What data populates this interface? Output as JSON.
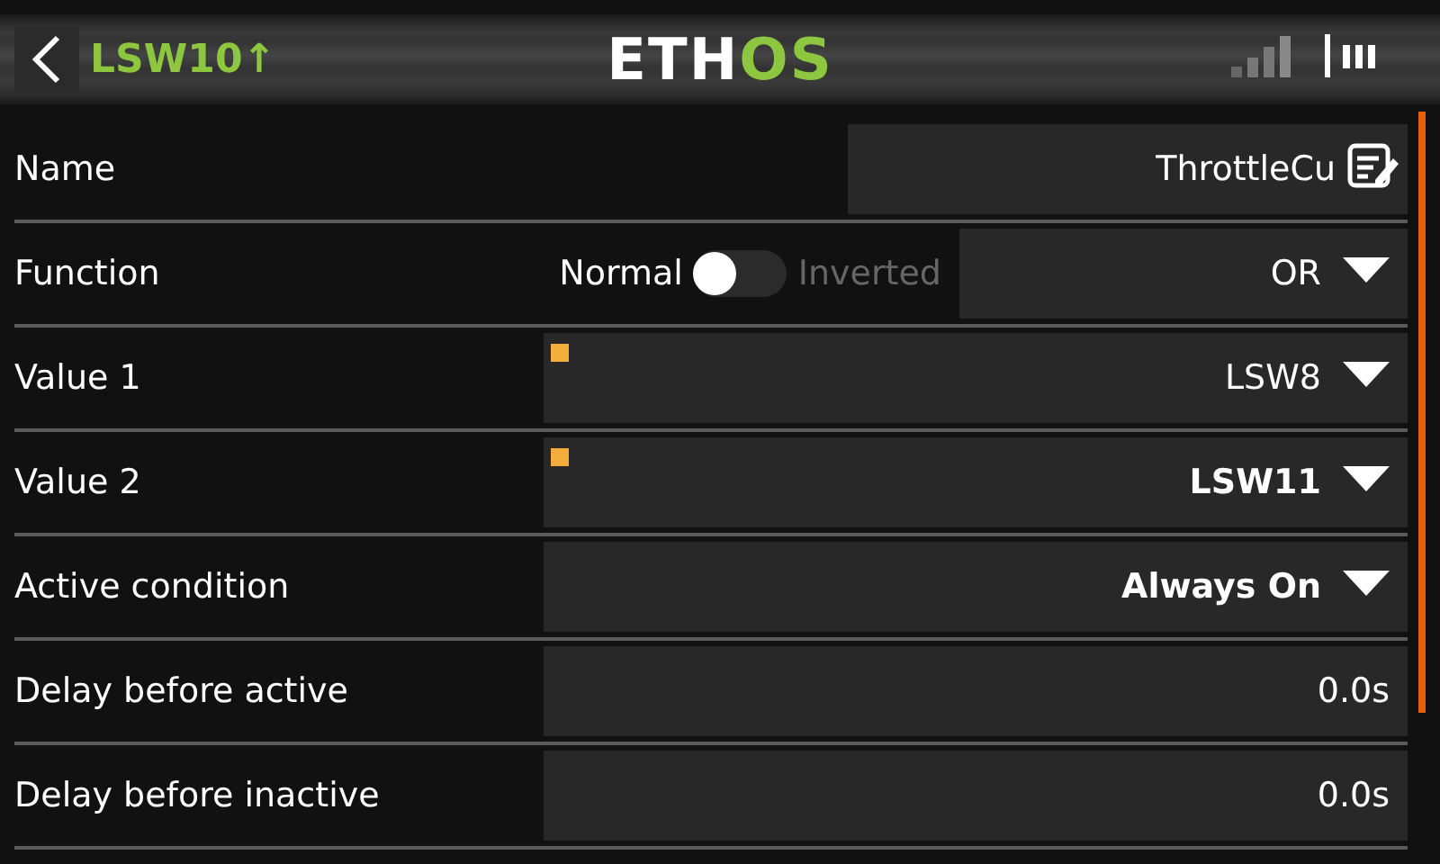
{
  "header": {
    "title": "LSW10↑",
    "logo": [
      "ETH",
      "OS"
    ]
  },
  "rows": [
    {
      "kind": "text",
      "label": "Name",
      "value": "ThrottleCu"
    },
    {
      "kind": "function",
      "label": "Function",
      "off_label": "Normal",
      "on_label": "Inverted",
      "on": false,
      "value": "OR",
      "bold": false
    },
    {
      "kind": "dropdown",
      "label": "Value 1",
      "value": "LSW8",
      "bold": false,
      "marker": true
    },
    {
      "kind": "dropdown",
      "label": "Value 2",
      "value": "LSW11",
      "bold": true,
      "marker": true
    },
    {
      "kind": "dropdown",
      "label": "Active condition",
      "value": "Always On",
      "bold": true,
      "marker": false
    },
    {
      "kind": "number",
      "label": "Delay before active",
      "value": "0.0s"
    },
    {
      "kind": "number",
      "label": "Delay before inactive",
      "value": "0.0s"
    }
  ]
}
